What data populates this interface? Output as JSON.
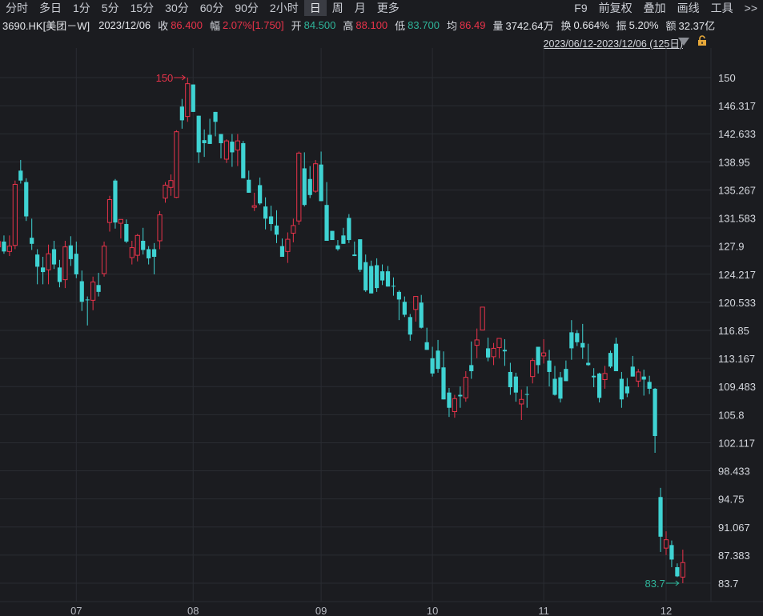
{
  "toolbar": {
    "left": [
      "分时",
      "多日",
      "1分",
      "5分",
      "15分",
      "30分",
      "60分",
      "90分",
      "2小时",
      "日",
      "周",
      "月",
      "更多"
    ],
    "active": "日",
    "right": [
      "F9",
      "前复权",
      "叠加",
      "画线",
      "工具",
      ">>"
    ]
  },
  "quote": {
    "symbol": "3690.HK[美团－W]",
    "date": "2023/12/06",
    "close_label": "收",
    "close": "86.400",
    "change_label": "幅",
    "change": "2.07%[1.750]",
    "open_label": "开",
    "open": "84.500",
    "high_label": "高",
    "high": "88.100",
    "low_label": "低",
    "low": "83.700",
    "avg_label": "均",
    "avg": "86.49",
    "volume_label": "量",
    "volume": "3742.64万",
    "turnover_label": "换",
    "turnover": "0.664%",
    "amplitude_label": "振",
    "amplitude": "5.20%",
    "amount_label": "额",
    "amount": "32.37亿"
  },
  "range": "2023/06/12-2023/12/06 (125日)",
  "colors": {
    "up": "#e8334a",
    "down": "#3fd3d3",
    "background": "#1b1c20",
    "grid": "#2a2c32",
    "text": "#d5d8de"
  },
  "icons": {
    "range_dropdown": "caret-down-icon",
    "lock": "lock-icon"
  },
  "chart_data": {
    "type": "candlestick",
    "ylim": [
      83.7,
      150
    ],
    "yticks": [
      "150",
      "146.317",
      "142.633",
      "138.95",
      "135.267",
      "131.583",
      "127.9",
      "124.217",
      "120.533",
      "116.85",
      "113.167",
      "109.483",
      "105.8",
      "102.117",
      "98.433",
      "94.75",
      "91.067",
      "87.383",
      "83.7"
    ],
    "xticks": [
      "07",
      "08",
      "09",
      "10",
      "11",
      "12"
    ],
    "max_annotation": "150",
    "min_annotation": "83.7",
    "candles": [
      [
        127.8,
        129,
        126.5,
        128.5
      ],
      [
        128.5,
        129.3,
        126.9,
        127.2
      ],
      [
        127.2,
        129.3,
        126.6,
        127.9
      ],
      [
        128,
        136.5,
        127.5,
        136
      ],
      [
        137.8,
        139.2,
        136.1,
        136.5
      ],
      [
        136.3,
        136.8,
        131.2,
        131.8
      ],
      [
        129,
        131.5,
        127.4,
        128.2
      ],
      [
        126.8,
        127.5,
        122.9,
        125.2
      ],
      [
        125.1,
        126.5,
        122.9,
        124.5
      ],
      [
        124.8,
        128.1,
        122.9,
        126.9
      ],
      [
        127.5,
        128.6,
        124.9,
        125.5
      ],
      [
        125.1,
        126.1,
        122.5,
        123.2
      ],
      [
        123.5,
        128.6,
        122.4,
        127.8
      ],
      [
        128,
        129.2,
        125.3,
        126.2
      ],
      [
        126.9,
        128.5,
        123.7,
        124.2
      ],
      [
        123.3,
        124.7,
        119.4,
        120.6
      ],
      [
        120.9,
        121.3,
        117.5,
        120.8
      ],
      [
        120.8,
        123.9,
        119.5,
        123.2
      ],
      [
        122.8,
        124.4,
        121.3,
        121.9
      ],
      [
        124.3,
        128.5,
        123.9,
        127.9
      ],
      [
        131,
        134.5,
        129.8,
        134
      ],
      [
        136.5,
        136.7,
        130.2,
        131
      ],
      [
        130.9,
        131.3,
        128.9,
        131.4
      ],
      [
        130.8,
        131.4,
        128.3,
        128.5
      ],
      [
        126.4,
        128.6,
        125.5,
        127.7
      ],
      [
        126.7,
        129.5,
        125.9,
        129.3
      ],
      [
        128.6,
        130.3,
        126.8,
        127.4
      ],
      [
        127.5,
        127.9,
        125.5,
        126.3
      ],
      [
        127.5,
        128.3,
        124.2,
        126.5
      ],
      [
        128.6,
        132.5,
        127.5,
        132
      ],
      [
        134.2,
        136.3,
        133.6,
        135.9
      ],
      [
        135.6,
        137.3,
        134.5,
        136.5
      ],
      [
        134.3,
        143.1,
        134.2,
        142.9
      ],
      [
        146.2,
        147.2,
        143.3,
        144.4
      ],
      [
        144.9,
        150,
        144.2,
        149.2
      ],
      [
        149.1,
        148.6,
        145.8,
        145.5
      ],
      [
        145,
        144.9,
        138.8,
        140.2
      ],
      [
        141.8,
        143.2,
        139.6,
        141.4
      ],
      [
        142.5,
        144.6,
        141.5,
        141.3
      ],
      [
        145.5,
        145.4,
        142.3,
        144.2
      ],
      [
        142.6,
        142.6,
        139.4,
        141.4
      ],
      [
        139.3,
        141.9,
        138.8,
        141.7
      ],
      [
        141.6,
        142.6,
        138.3,
        140.2
      ],
      [
        140.5,
        142.6,
        138.4,
        141.7
      ],
      [
        141.4,
        141.7,
        136.9,
        136.8
      ],
      [
        136.6,
        137.8,
        135.1,
        134.9
      ],
      [
        133,
        134.9,
        132.5,
        133.2
      ],
      [
        135.9,
        136.9,
        133.3,
        133.5
      ],
      [
        133.1,
        134.3,
        130.1,
        131.5
      ],
      [
        131.8,
        133.2,
        129.9,
        130.8
      ],
      [
        130.6,
        132.6,
        128.3,
        129.4
      ],
      [
        127.9,
        128.9,
        126.5,
        126.5
      ],
      [
        127.2,
        129.7,
        125.7,
        128.8
      ],
      [
        129.6,
        131.5,
        128.4,
        130.6
      ],
      [
        131.2,
        140.3,
        130.7,
        140.1
      ],
      [
        138.1,
        140.2,
        133.1,
        133.3
      ],
      [
        136.7,
        138.4,
        134.2,
        134.6
      ],
      [
        135.1,
        139.2,
        134.9,
        138.7
      ],
      [
        138.6,
        140.3,
        134.8,
        133.8
      ],
      [
        133.3,
        136.3,
        129.4,
        128.6
      ],
      [
        129.9,
        128.9,
        128.9,
        128.7
      ],
      [
        128,
        128.7,
        127.3,
        127.5
      ],
      [
        129.3,
        130.3,
        128.2,
        128.2
      ],
      [
        131.6,
        132.1,
        128.3,
        128.7
      ],
      [
        126.8,
        128.5,
        127.2,
        126.6
      ],
      [
        128.8,
        128.3,
        124.5,
        124.8
      ],
      [
        125.8,
        126.8,
        121.9,
        122.1
      ],
      [
        125.3,
        126,
        123.6,
        121.7
      ],
      [
        125.4,
        126.3,
        121.9,
        122.4
      ],
      [
        124.6,
        125.5,
        122.8,
        123.4
      ],
      [
        124.6,
        125.3,
        122.8,
        122.6
      ],
      [
        122.7,
        123.8,
        121.4,
        122.6
      ],
      [
        121.9,
        122.1,
        118.2,
        120.9
      ],
      [
        120.6,
        121.3,
        118.6,
        118.9
      ],
      [
        118.6,
        119,
        115.5,
        116.3
      ],
      [
        119.6,
        121.3,
        118,
        121.3
      ],
      [
        120.5,
        121.5,
        117.1,
        117.2
      ],
      [
        115.3,
        117.2,
        114.6,
        114.3
      ],
      [
        113.2,
        114.7,
        110.8,
        111.2
      ],
      [
        114.2,
        115.6,
        111.3,
        111.8
      ],
      [
        112,
        114.1,
        108.2,
        107.8
      ],
      [
        108.7,
        109.3,
        105.5,
        106.7
      ],
      [
        106.2,
        108.4,
        105.4,
        107.9
      ],
      [
        108.4,
        109.5,
        106.7,
        108.2
      ],
      [
        108,
        111.5,
        107.5,
        110.7
      ],
      [
        112.3,
        115.4,
        110.5,
        111.5
      ],
      [
        114.9,
        117.1,
        113.2,
        115.6
      ],
      [
        116.9,
        119.5,
        117.2,
        119.9
      ],
      [
        114.5,
        115.9,
        112.8,
        113.3
      ],
      [
        113.4,
        115.2,
        112.3,
        114.5
      ],
      [
        114.6,
        115.6,
        113.2,
        115.8
      ],
      [
        114.3,
        115.7,
        112.2,
        114.1
      ],
      [
        111.4,
        112.6,
        108.4,
        109.4
      ],
      [
        110.8,
        111.3,
        107.5,
        108.7
      ],
      [
        107.2,
        109.1,
        105.1,
        107.8
      ],
      [
        108.5,
        109.5,
        106.7,
        108.4
      ],
      [
        110.8,
        113.2,
        109.9,
        112.9
      ],
      [
        114.7,
        114.4,
        111.2,
        112.3
      ],
      [
        113.5,
        115.7,
        112.5,
        113.9
      ],
      [
        112.9,
        114.3,
        109.5,
        111.4
      ],
      [
        110.5,
        112.2,
        108.3,
        108.4
      ],
      [
        110.7,
        111.4,
        107.4,
        107.9
      ],
      [
        111.8,
        112.9,
        110.8,
        110.2
      ],
      [
        116.6,
        118.2,
        113,
        114.5
      ],
      [
        116.5,
        116.9,
        114.8,
        115.3
      ],
      [
        115.2,
        117.7,
        113.1,
        114.6
      ],
      [
        112.6,
        115.1,
        112.2,
        112.3
      ],
      [
        110.9,
        111.9,
        109.4,
        110.7
      ],
      [
        111.2,
        111.3,
        107.4,
        108
      ],
      [
        110.4,
        112.2,
        109.2,
        111.2
      ],
      [
        113.9,
        114.2,
        111.9,
        112.1
      ],
      [
        115.1,
        115.9,
        111.7,
        111.5
      ],
      [
        110.5,
        111.4,
        106.7,
        107.8
      ],
      [
        109.5,
        110.6,
        108.1,
        108.6
      ],
      [
        112.1,
        113.5,
        110.8,
        110.8
      ],
      [
        110.2,
        111.8,
        109.4,
        111.4
      ],
      [
        110.8,
        111.7,
        108.3,
        110.4
      ],
      [
        110.1,
        110.9,
        108.5,
        109.2
      ],
      [
        109.2,
        109.3,
        100.8,
        103
      ],
      [
        95,
        96.2,
        87.8,
        89.8
      ],
      [
        88.3,
        90.5,
        87.4,
        89.4
      ],
      [
        88.7,
        89.3,
        85.8,
        86.8
      ],
      [
        85.8,
        86.3,
        84.5,
        84.6
      ],
      [
        84.5,
        88.1,
        83.7,
        86.4
      ]
    ]
  }
}
